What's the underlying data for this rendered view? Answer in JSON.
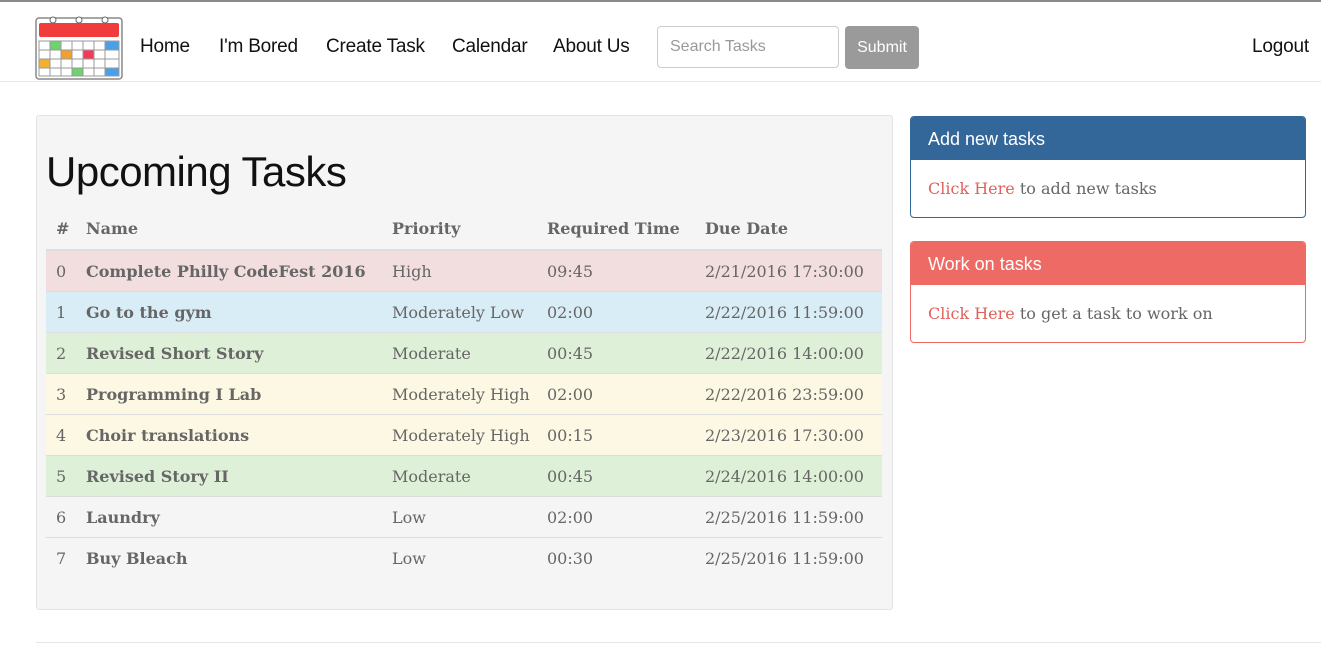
{
  "nav": {
    "links": [
      "Home",
      "I'm Bored",
      "Create Task",
      "Calendar",
      "About Us"
    ],
    "search_placeholder": "Search Tasks",
    "submit_label": "Submit",
    "logout_label": "Logout",
    "logo_icon": "calendar-icon"
  },
  "main": {
    "title": "Upcoming Tasks",
    "columns": [
      "#",
      "Name",
      "Priority",
      "Required Time",
      "Due Date"
    ],
    "rows": [
      {
        "num": "0",
        "name": "Complete Philly CodeFest 2016",
        "priority": "High",
        "time": "09:45",
        "due": "2/21/2016 17:30:00",
        "status": "danger"
      },
      {
        "num": "1",
        "name": "Go to the gym",
        "priority": "Moderately Low",
        "time": "02:00",
        "due": "2/22/2016 11:59:00",
        "status": "info"
      },
      {
        "num": "2",
        "name": "Revised Short Story",
        "priority": "Moderate",
        "time": "00:45",
        "due": "2/22/2016 14:00:00",
        "status": "success"
      },
      {
        "num": "3",
        "name": "Programming I Lab",
        "priority": "Moderately High",
        "time": "02:00",
        "due": "2/22/2016 23:59:00",
        "status": "warning"
      },
      {
        "num": "4",
        "name": "Choir translations",
        "priority": "Moderately High",
        "time": "00:15",
        "due": "2/23/2016 17:30:00",
        "status": "warning"
      },
      {
        "num": "5",
        "name": "Revised Story II",
        "priority": "Moderate",
        "time": "00:45",
        "due": "2/24/2016 14:00:00",
        "status": "success"
      },
      {
        "num": "6",
        "name": "Laundry",
        "priority": "Low",
        "time": "02:00",
        "due": "2/25/2016 11:59:00",
        "status": "none"
      },
      {
        "num": "7",
        "name": "Buy Bleach",
        "priority": "Low",
        "time": "00:30",
        "due": "2/25/2016 11:59:00",
        "status": "none"
      }
    ]
  },
  "panels": {
    "add": {
      "heading": "Add new tasks",
      "link": "Click Here",
      "text": " to add new tasks",
      "color": "#336699"
    },
    "work": {
      "heading": "Work on tasks",
      "link": "Click Here",
      "text": " to get a task to work on",
      "color": "#ee6a64"
    }
  }
}
